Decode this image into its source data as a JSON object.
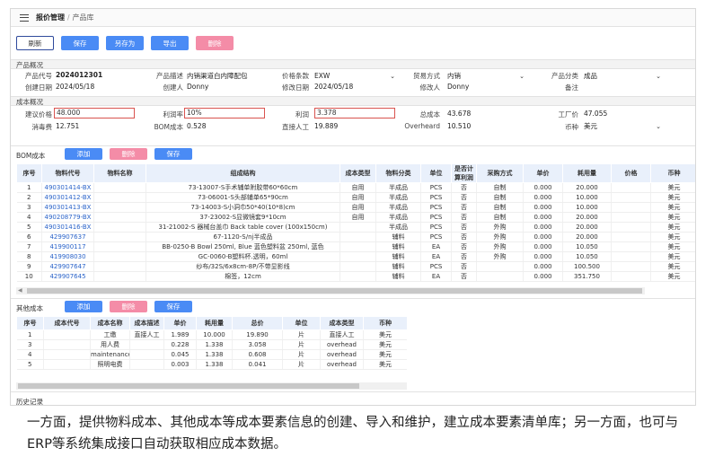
{
  "header": {
    "menu_icon": "menu-icon",
    "crumb1": "报价管理",
    "sep": "/",
    "crumb2": "产品库"
  },
  "toolbar": {
    "refresh": "刷新",
    "save": "保存",
    "save_as": "另存为",
    "export": "导出",
    "delete": "删除"
  },
  "overview": {
    "title": "产品概况",
    "code_label": "产品代号",
    "code": "2024012301",
    "desc_label": "产品描述",
    "desc": "内销渠道白内障配包",
    "price_terms_label": "价格条款",
    "price_terms": "EXW",
    "trade_label": "贸易方式",
    "trade": "内销",
    "category_label": "产品分类",
    "category": "成品",
    "created_date_label": "创建日期",
    "created_date": "2024/05/18",
    "creator_label": "创建人",
    "creator": "Donny",
    "modified_date_label": "修改日期",
    "modified_date": "2024/05/18",
    "modifier_label": "修改人",
    "modifier": "Donny",
    "remark_label": "备注"
  },
  "cost": {
    "title": "成本概况",
    "suggest_label": "建议价格",
    "suggest": "48.000",
    "profit_rate_label": "利润率",
    "profit_rate": "10%",
    "profit_label": "利润",
    "profit": "3.378",
    "total_label": "总成本",
    "total": "43.678",
    "factory_label": "工厂价",
    "factory": "47.055",
    "disinfect_label": "消毒费",
    "disinfect": "12.751",
    "bom_label": "BOM成本",
    "bom": "0.528",
    "labor_label": "直接人工",
    "labor": "19.889",
    "overhead_label": "Overheard",
    "overhead": "10.510",
    "currency_label": "币种",
    "currency": "美元"
  },
  "bom": {
    "title": "BOM成本",
    "add": "添加",
    "delete": "删除",
    "save": "保存",
    "headers": [
      "序号",
      "物料代号",
      "物料名称",
      "组成结构",
      "成本类型",
      "物料分类",
      "单位",
      "是否计算利润",
      "采购方式",
      "单价",
      "耗用量",
      "价格",
      "币种"
    ],
    "rows": [
      [
        "1",
        "490301414-BX",
        "",
        "73-13007-S手术辅单附胶带60*60cm",
        "自用",
        "半成品",
        "PCS",
        "否",
        "自制",
        "0.000",
        "20.000",
        "",
        "美元"
      ],
      [
        "2",
        "490301412-BX",
        "",
        "73-06001-S头部辅单65*90cm",
        "自用",
        "半成品",
        "PCS",
        "否",
        "自制",
        "0.000",
        "10.000",
        "",
        "美元"
      ],
      [
        "3",
        "490301413-BX",
        "",
        "73-14003-S小洞巾50*40(10*8)cm",
        "自用",
        "半成品",
        "PCS",
        "否",
        "自制",
        "0.000",
        "10.000",
        "",
        "美元"
      ],
      [
        "4",
        "490208779-BX",
        "",
        "37-23002-S显微镜套9*10cm",
        "自用",
        "半成品",
        "PCS",
        "否",
        "自制",
        "0.000",
        "20.000",
        "",
        "美元"
      ],
      [
        "5",
        "490301416-BX",
        "",
        "31-21002-S 器械台盖巾 Back table cover (100x150cm)",
        "",
        "半成品",
        "PCS",
        "否",
        "外购",
        "0.000",
        "20.000",
        "",
        "美元"
      ],
      [
        "6",
        "429907637",
        "",
        "67-1120-S/nj半成品",
        "",
        "辅料",
        "PCS",
        "否",
        "外购",
        "0.000",
        "20.000",
        "",
        "美元"
      ],
      [
        "7",
        "419900117",
        "",
        "BB-0250-B Bowl 250ml, Blue 蓝色塑料盆 250ml, 蓝色",
        "",
        "辅料",
        "EA",
        "否",
        "外购",
        "0.000",
        "10.050",
        "",
        "美元"
      ],
      [
        "8",
        "419908030",
        "",
        "GC-0060-B塑料杯.透明，60ml",
        "",
        "辅料",
        "EA",
        "否",
        "外购",
        "0.000",
        "10.050",
        "",
        "美元"
      ],
      [
        "9",
        "429907647",
        "",
        "纱布/32S/6x8cm-8P/不带显影线",
        "",
        "辅料",
        "PCS",
        "否",
        "",
        "0.000",
        "100.500",
        "",
        "美元"
      ],
      [
        "10",
        "429907645",
        "",
        "棉签，12cm",
        "",
        "辅料",
        "EA",
        "否",
        "",
        "0.000",
        "351.750",
        "",
        "美元"
      ]
    ]
  },
  "other": {
    "title": "其他成本",
    "add": "添加",
    "delete": "删除",
    "save": "保存",
    "headers": [
      "序号",
      "成本代号",
      "成本名称",
      "成本描述",
      "单价",
      "耗用量",
      "总价",
      "单位",
      "成本类型",
      "币种"
    ],
    "rows": [
      [
        "1",
        "",
        "工缴",
        "直接人工",
        "1.989",
        "10.000",
        "19.890",
        "片",
        "直接人工",
        "美元"
      ],
      [
        "3",
        "",
        "用人费",
        "",
        "0.228",
        "1.338",
        "3.058",
        "片",
        "overhead",
        "美元"
      ],
      [
        "4",
        "",
        "maintenance",
        "",
        "0.045",
        "1.338",
        "0.608",
        "片",
        "overhead",
        "美元"
      ],
      [
        "5",
        "",
        "照明电费",
        "",
        "0.003",
        "1.338",
        "0.041",
        "片",
        "overhead",
        "美元"
      ]
    ]
  },
  "history_label": "历史记录",
  "caption": "一方面，提供物料成本、其他成本等成本要素信息的创建、导入和维护，建立成本要素清单库；另一方面，也可与ERP等系统集成接口自动获取相应成本数据。"
}
